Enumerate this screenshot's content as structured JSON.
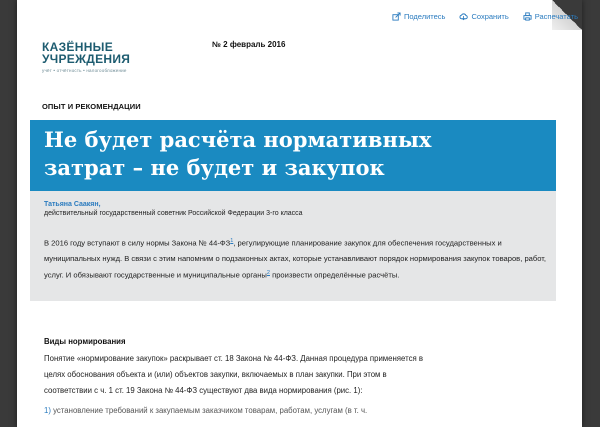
{
  "toolbar": {
    "share_label": "Поделитесь",
    "save_label": "Сохранить",
    "print_label": "Распечатать"
  },
  "logo": {
    "line1": "КАЗЁННЫЕ",
    "line2": "УЧРЕЖДЕНИЯ",
    "tagline": "учёт • отчётность • налогообложение"
  },
  "issue": "№ 2 февраль 2016",
  "section": "ОПЫТ И РЕКОМЕНДАЦИИ",
  "article": {
    "title_line1": "Не будет расчёта нормативных",
    "title_line2": "затрат – не будет и закупок",
    "author_name": "Татьяна Саакян,",
    "author_title": "действительный государственный советник Российской Федерации 3-го класса",
    "lead_part1": "В 2016 году вступают в силу нормы Закона № 44-ФЗ",
    "lead_ref1": "1",
    "lead_part2": ", регулирующие планирование закупок для обеспечения государственных и муниципальных нужд. В связи с этим напомним о подзаконных актах, которые устанавливают порядок нормирования закупок товаров, работ, услуг. И обязывают государственные и муниципальные органы",
    "lead_ref2": "2",
    "lead_part3": " произвести определённые расчёты.",
    "subhead": "Виды нормирования",
    "body": "Понятие «нормирование закупок» раскрывает ст. 18 Закона № 44-ФЗ. Данная процедура применяется в целях обоснования объекта и (или) объектов закупки, включаемых в план закупки. При этом в соответствии с ч. 1 ст. 19 Закона № 44-ФЗ существуют два вида нормирования (рис. 1):",
    "cut_num": "1)",
    "cut_text": " установление требований к закупаемым заказчиком товарам, работам, услугам (в т. ч."
  },
  "colors": {
    "accent_blue": "#1a8ac1",
    "link_blue": "#2a7bbf",
    "logo_teal": "#1d5c70",
    "gray_panel": "#e5e6e7"
  }
}
